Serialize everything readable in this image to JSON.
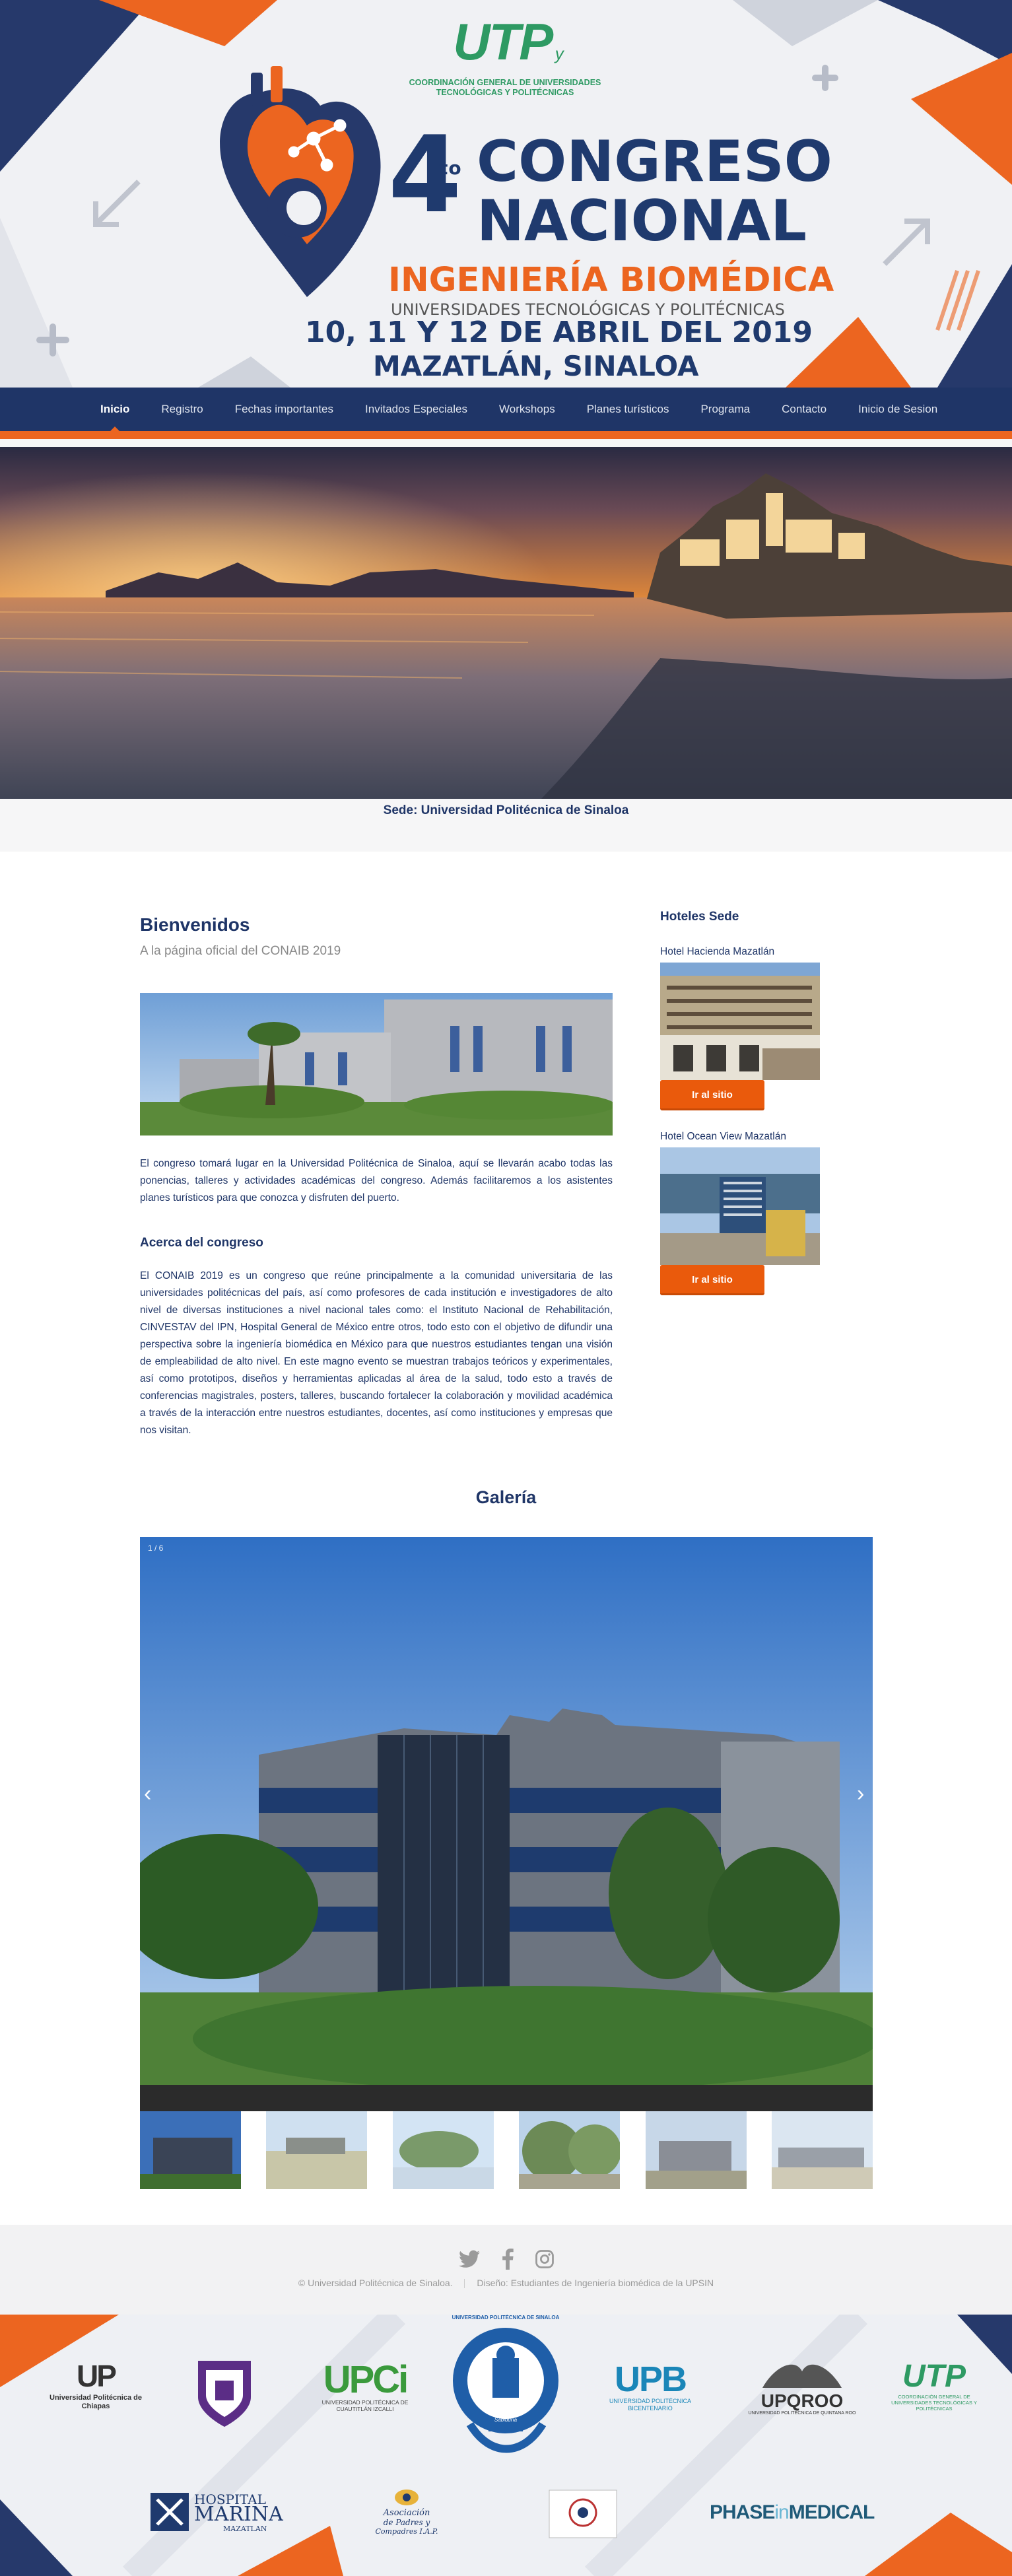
{
  "header": {
    "org_abbr": "UTP",
    "org_small": "y",
    "org_line1": "COORDINACIÓN GENERAL DE UNIVERSIDADES",
    "org_line2": "TECNOLÓGICAS Y POLITÉCNICAS",
    "edition_number": "4",
    "edition_suffix": "to",
    "title_line1": "CONGRESO",
    "title_line2": "NACIONAL",
    "subtitle": "INGENIERÍA BIOMÉDICA",
    "subtitle2": "UNIVERSIDADES TECNOLÓGICAS Y POLITÉCNICAS",
    "dates": "10, 11 Y 12 DE ABRIL DEL 2019",
    "location": "MAZATLÁN, SINALOA",
    "colors": {
      "navy": "#1f3567",
      "orange": "#ec6520",
      "green": "#2e9a63"
    }
  },
  "nav": {
    "items": [
      {
        "label": "Inicio"
      },
      {
        "label": "Registro"
      },
      {
        "label": "Fechas importantes"
      },
      {
        "label": "Invitados Especiales"
      },
      {
        "label": "Workshops"
      },
      {
        "label": "Planes turísticos"
      },
      {
        "label": "Programa"
      },
      {
        "label": "Contacto"
      },
      {
        "label": "Inicio de Sesion"
      }
    ]
  },
  "hero": {
    "caption": "Sede: Universidad Politécnica de Sinaloa"
  },
  "welcome": {
    "title": "Bienvenidos",
    "subtitle": "A la página oficial del CONAIB 2019",
    "intro": "El congreso tomará lugar en la Universidad Politécnica de Sinaloa, aquí se llevarán acabo todas las ponencias, talleres y actividades académicas del congreso. Además facilitaremos a los asistentes planes turísticos para que conozca y disfruten del puerto."
  },
  "about": {
    "title": "Acerca del congreso",
    "text": "El CONAIB 2019 es un congreso que reúne principalmente a la comunidad universitaria de las universidades politécnicas del país, así como profesores de cada institución e investigadores de alto nivel de diversas instituciones a nivel nacional tales como: el Instituto Nacional de Rehabilitación, CINVESTAV del IPN, Hospital General de México entre otros, todo esto con el objetivo de difundir una perspectiva sobre la ingeniería biomédica en México para que nuestros estudiantes tengan una visión de empleabilidad de alto nivel. En este magno evento se muestran trabajos teóricos y experimentales, así como prototipos, diseños y herramientas aplicadas al área de la salud, todo esto a través de conferencias magistrales, posters, talleres, buscando fortalecer la colaboración y movilidad académica a través de la interacción entre nuestros estudiantes, docentes, así como instituciones y empresas que nos visitan."
  },
  "hotels": {
    "title": "Hoteles Sede",
    "items": [
      {
        "name": "Hotel Hacienda Mazatlán",
        "button": "Ir al sitio"
      },
      {
        "name": "Hotel Ocean View Mazatlán",
        "button": "Ir al sitio"
      }
    ]
  },
  "gallery": {
    "title": "Galería",
    "counter": "1 / 6",
    "prev": "‹",
    "next": "›"
  },
  "footer": {
    "social": [
      "twitter-icon",
      "facebook-icon",
      "instagram-icon"
    ],
    "copyright": "© Universidad Politécnica de Sinaloa.",
    "design": "Diseño: Estudiantes de Ingeniería biomédica de la UPSIN"
  },
  "sponsors": {
    "up_chiapas_abbr": "UP",
    "up_chiapas_name": "Universidad Politécnica de Chiapas",
    "upci_abbr": "UPCi",
    "upci_name": "UNIVERSIDAD POLITÉCNICA DE CUAUTITLÁN IZCALLI",
    "upsin_name": "UNIVERSIDAD POLITÉCNICA DE SINALOA",
    "upsin_motto": "Sabiduría",
    "upb_abbr": "UPB",
    "upb_name": "UNIVERSIDAD POLITÉCNICA BICENTENARIO",
    "upqroo_abbr": "UPQROO",
    "upqroo_name": "UNIVERSIDAD POLITÉCNICA DE QUINTANA ROO",
    "utp_abbr": "UTP",
    "utp_name": "COORDINACIÓN GENERAL DE UNIVERSIDADES TECNOLÓGICAS Y POLITÉCNICAS",
    "hospital_line1": "HOSPITAL",
    "hospital_line2": "MARINA",
    "hospital_line3": "MAZATLAN",
    "asoc_line1": "Asociación",
    "asoc_line2": "de Padres y",
    "asoc_line3": "Compadres I.A.P.",
    "phase_a": "PHASE",
    "phase_b": "in",
    "phase_c": "MEDICAL"
  }
}
